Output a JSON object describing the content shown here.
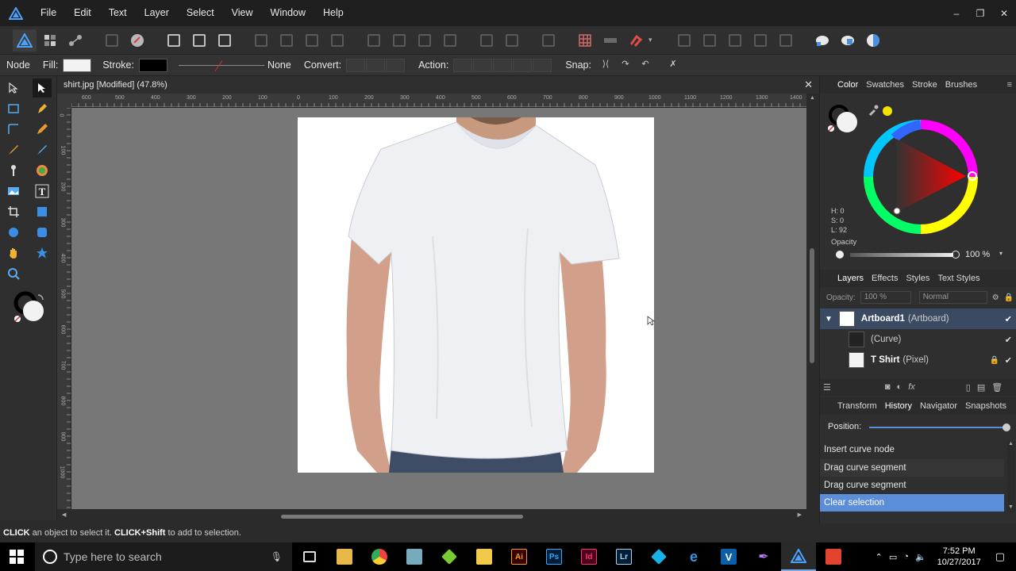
{
  "menu": [
    "File",
    "Edit",
    "Text",
    "Layer",
    "Select",
    "View",
    "Window",
    "Help"
  ],
  "window_controls": [
    "–",
    "❐",
    "✕"
  ],
  "context": {
    "mode": "Node",
    "fill_label": "Fill:",
    "stroke_label": "Stroke:",
    "stroke_none": "None",
    "convert_label": "Convert:",
    "action_label": "Action:",
    "snap_label": "Snap:",
    "fill_color": "#f2f2f2",
    "stroke_color": "#000000"
  },
  "document": {
    "title": "shirt.jpg [Modified] (47.8%)",
    "close": "✕",
    "ruler_h": [
      "600",
      "500",
      "400",
      "300",
      "200",
      "100",
      "0",
      "100",
      "200",
      "300",
      "400",
      "500",
      "600",
      "700",
      "800",
      "900",
      "1000",
      "1100",
      "1200",
      "1300",
      "1400"
    ],
    "ruler_v": [
      "0",
      "100",
      "200",
      "300",
      "400",
      "500",
      "600",
      "700",
      "800",
      "900",
      "1000"
    ]
  },
  "color_panel": {
    "tabs": [
      "Color",
      "Swatches",
      "Stroke",
      "Brushes"
    ],
    "h": "H: 0",
    "s": "S: 0",
    "l": "L: 92",
    "opacity_label": "Opacity",
    "opacity_value": "100 %"
  },
  "layers_panel": {
    "tabs": [
      "Layers",
      "Effects",
      "Styles",
      "Text Styles"
    ],
    "opacity_label": "Opacity:",
    "opacity_value": "100 %",
    "blend_mode": "Normal",
    "layers": [
      {
        "name": "Artboard1",
        "type": "(Artboard)"
      },
      {
        "name": "",
        "type": "(Curve)"
      },
      {
        "name": "T Shirt",
        "type": "(Pixel)"
      }
    ]
  },
  "history_panel": {
    "tabs": [
      "Transform",
      "History",
      "Navigator",
      "Snapshots"
    ],
    "position_label": "Position:",
    "items": [
      "Insert curve node",
      "Drag curve segment",
      "Drag curve segment",
      "Clear selection"
    ]
  },
  "status": {
    "k1": "CLICK",
    "t1": " an object to select it. ",
    "k2": "CLICK+Shift",
    "t2": " to add to selection."
  },
  "taskbar": {
    "search_placeholder": "Type here to search",
    "apps": [
      "Ai",
      "Ps",
      "Id",
      "Lr",
      "V"
    ],
    "time": "7:52 PM",
    "date": "10/27/2017"
  },
  "colors": {
    "accent": "#5b8dd9",
    "canvas": "#777777",
    "panel": "#2f2f2f"
  }
}
